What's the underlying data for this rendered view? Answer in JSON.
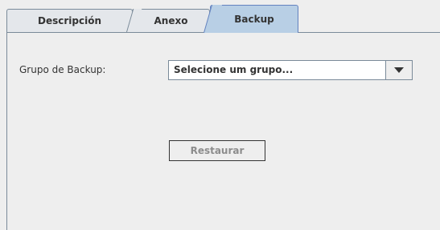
{
  "tabs": [
    {
      "label": "Descripción",
      "selected": false
    },
    {
      "label": "Anexo",
      "selected": false
    },
    {
      "label": "Backup",
      "selected": true
    }
  ],
  "backup_panel": {
    "group_label": "Grupo de Backup:",
    "group_select": {
      "value": "Selecione um grupo...",
      "arrow_icon": "triangle-down-icon"
    },
    "restore_button": {
      "label": "Restaurar",
      "enabled": false
    }
  },
  "colors": {
    "selected_tab": "#b8cfe5",
    "tab_background": "#e4e7eb",
    "border": "#7a8a99",
    "disabled_text": "#8c8c8c"
  }
}
